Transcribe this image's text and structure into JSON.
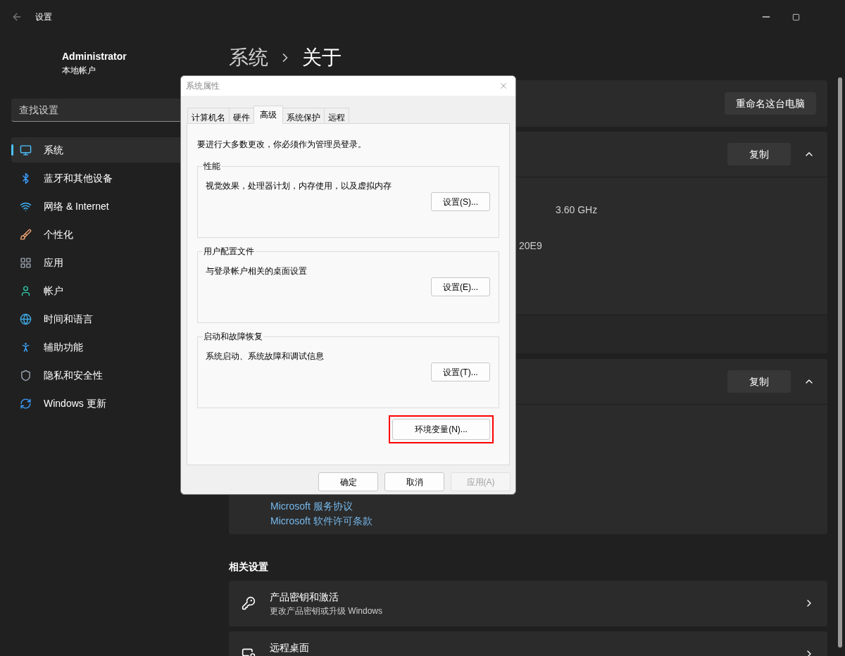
{
  "window": {
    "title": "设置"
  },
  "account": {
    "name": "Administrator",
    "type": "本地帐户"
  },
  "search": {
    "placeholder": "查找设置"
  },
  "sidebar": {
    "items": [
      {
        "label": "系统",
        "selected": true
      },
      {
        "label": "蓝牙和其他设备",
        "selected": false
      },
      {
        "label": "网络 & Internet",
        "selected": false
      },
      {
        "label": "个性化",
        "selected": false
      },
      {
        "label": "应用",
        "selected": false
      },
      {
        "label": "帐户",
        "selected": false
      },
      {
        "label": "时间和语言",
        "selected": false
      },
      {
        "label": "辅助功能",
        "selected": false
      },
      {
        "label": "隐私和安全性",
        "selected": false
      },
      {
        "label": "Windows 更新",
        "selected": false
      }
    ]
  },
  "breadcrumb": [
    "系统",
    "关于"
  ],
  "device_card": {
    "button": "重命名这台电脑"
  },
  "device_spec_card": {
    "button": "复制",
    "expanded": true,
    "values": [
      "3.60 GHz",
      "20E9"
    ]
  },
  "windows_spec_card": {
    "button": "复制",
    "expanded": true,
    "links": [
      "Microsoft 服务协议",
      "Microsoft 软件许可条款"
    ]
  },
  "related": {
    "title": "相关设置",
    "items": [
      {
        "title": "产品密钥和激活",
        "subtitle": "更改产品密钥或升级 Windows"
      },
      {
        "title": "远程桌面"
      }
    ]
  },
  "dialog": {
    "title": "系统属性",
    "tabs": [
      {
        "label": "计算机名",
        "selected": false
      },
      {
        "label": "硬件",
        "selected": false
      },
      {
        "label": "高级",
        "selected": true
      },
      {
        "label": "系统保护",
        "selected": false
      },
      {
        "label": "远程",
        "selected": false
      }
    ],
    "note": "要进行大多数更改，你必须作为管理员登录。",
    "groups": [
      {
        "title": "性能",
        "description": "视觉效果，处理器计划，内存使用，以及虚拟内存",
        "button": "设置(S)..."
      },
      {
        "title": "用户配置文件",
        "description": "与登录帐户相关的桌面设置",
        "button": "设置(E)..."
      },
      {
        "title": "启动和故障恢复",
        "description": "系统启动、系统故障和调试信息",
        "button": "设置(T)..."
      }
    ],
    "env_button": {
      "label": "环境变量(N)...",
      "highlighted": true
    },
    "buttons": [
      {
        "label": "确定",
        "disabled": false
      },
      {
        "label": "取消",
        "disabled": false
      },
      {
        "label": "应用(A)",
        "disabled": true
      }
    ]
  }
}
